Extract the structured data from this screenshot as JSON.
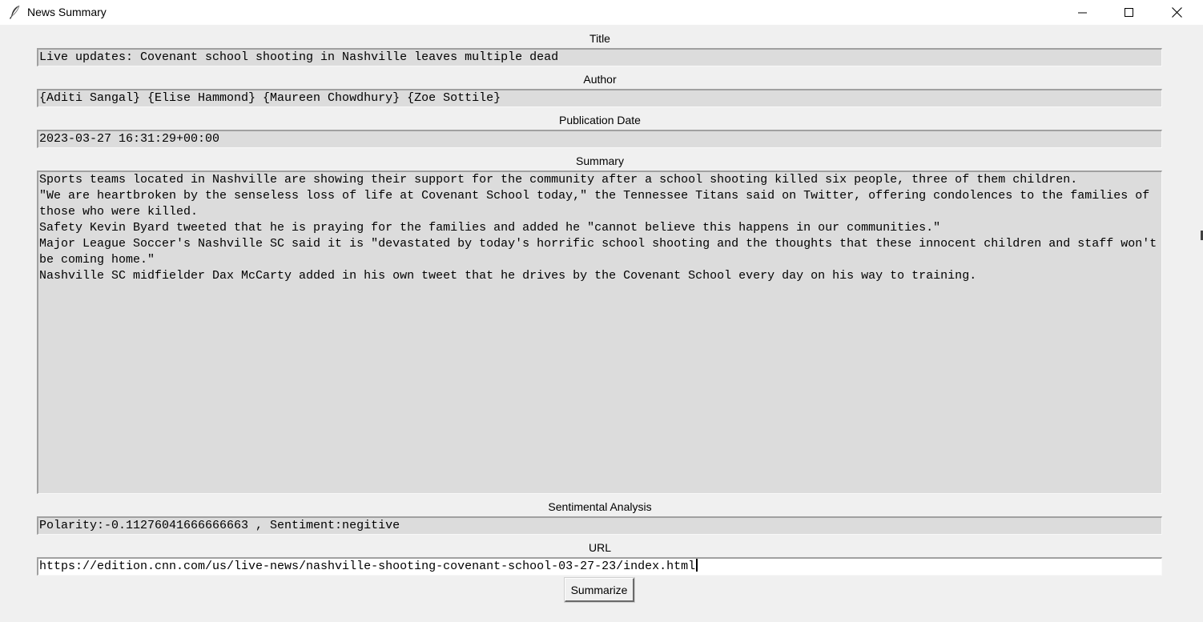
{
  "window": {
    "title": "News Summary",
    "icon": "feather-icon",
    "controls": [
      "minimize-icon",
      "maximize-icon",
      "close-icon"
    ]
  },
  "fields": {
    "title": {
      "label": "Title",
      "value": "Live updates: Covenant school shooting in Nashville leaves multiple dead"
    },
    "author": {
      "label": "Author",
      "value": "{Aditi Sangal} {Elise Hammond} {Maureen Chowdhury} {Zoe Sottile}"
    },
    "publication_date": {
      "label": "Publication Date",
      "value": "2023-03-27 16:31:29+00:00"
    },
    "summary": {
      "label": "Summary",
      "paragraphs": [
        "Sports teams located in Nashville are showing their support for the community after a school shooting killed six people, three of them children.",
        "\"We are heartbroken by the senseless loss of life at Covenant School today,\" the Tennessee Titans said on Twitter, offering condolences to the families of those who were killed.",
        "Safety Kevin Byard tweeted that he is praying for the families and added he \"cannot believe this happens in our communities.\"",
        "Major League Soccer's Nashville SC said it is \"devastated by today's horrific school shooting and the thoughts that these innocent children and staff won't be coming home.\"",
        "Nashville SC midfielder Dax McCarty added in his own tweet that he drives by the Covenant School every day on his way to training."
      ]
    },
    "sentiment": {
      "label": "Sentimental Analysis",
      "value": "Polarity:-0.11276041666666663 , Sentiment:negitive"
    },
    "url": {
      "label": "URL",
      "value": "https://edition.cnn.com/us/live-news/nashville-shooting-covenant-school-03-27-23/index.html"
    }
  },
  "actions": {
    "summarize_label": "Summarize"
  },
  "colors": {
    "window_bg": "#f0f0f0",
    "readonly_field_bg": "#dcdcdc",
    "input_bg": "#ffffff"
  }
}
